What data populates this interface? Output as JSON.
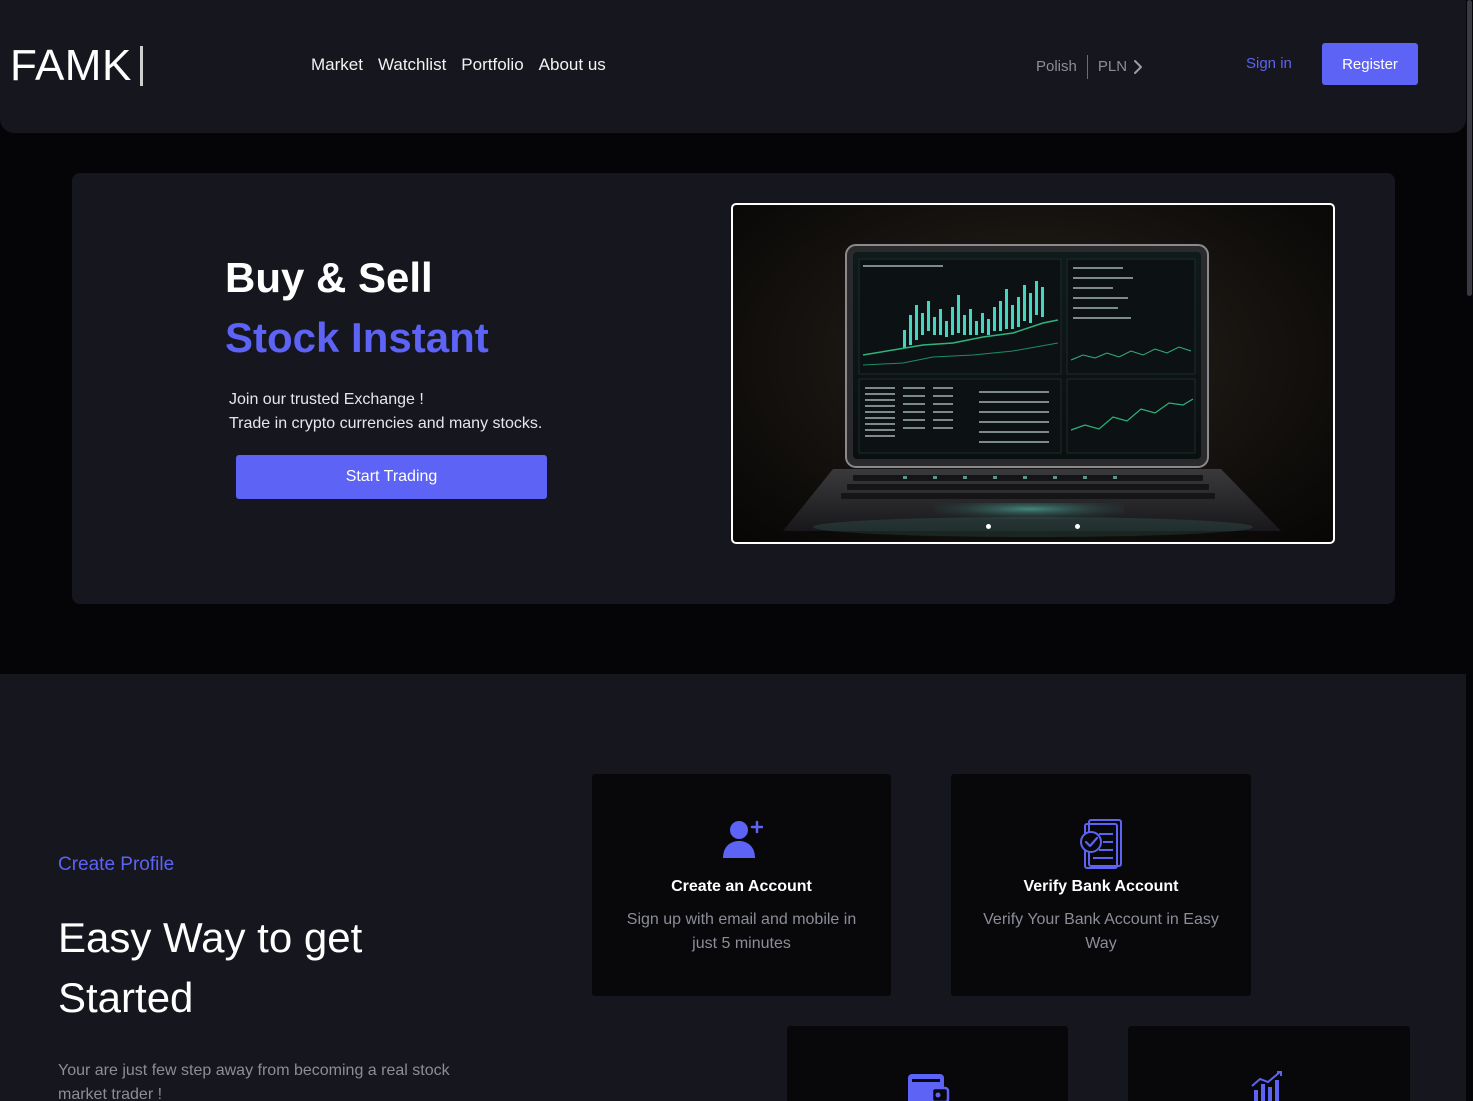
{
  "brand": {
    "logo": "FAMK"
  },
  "nav": {
    "links": [
      "Market",
      "Watchlist",
      "Portfolio",
      "About us"
    ],
    "language": "Polish",
    "currency": "PLN",
    "signin": "Sign in",
    "register": "Register"
  },
  "hero": {
    "title_line1": "Buy & Sell",
    "title_line2": "Stock Instant",
    "subtitle_line1": "Join our trusted Exchange !",
    "subtitle_line2": "Trade in crypto currencies and many stocks.",
    "cta": "Start Trading",
    "carousel_slides": 2
  },
  "steps_section": {
    "kicker": "Create Profile",
    "title": "Easy Way to get Started",
    "description": "Your are just few step away from becoming a real stock market trader !",
    "cards": [
      {
        "icon": "add-user-icon",
        "title": "Create an Account",
        "text": "Sign up with email and mobile in just 5 minutes"
      },
      {
        "icon": "verify-document-icon",
        "title": "Verify Bank Account",
        "text": "Verify Your Bank Account in Easy Way"
      },
      {
        "icon": "wallet-icon",
        "title": "",
        "text": ""
      },
      {
        "icon": "growth-chart-icon",
        "title": "",
        "text": ""
      }
    ]
  },
  "colors": {
    "accent": "#5c63f5",
    "surface": "#16161e",
    "background": "#050507",
    "card": "#08080b",
    "muted_text": "#8b8d98"
  }
}
